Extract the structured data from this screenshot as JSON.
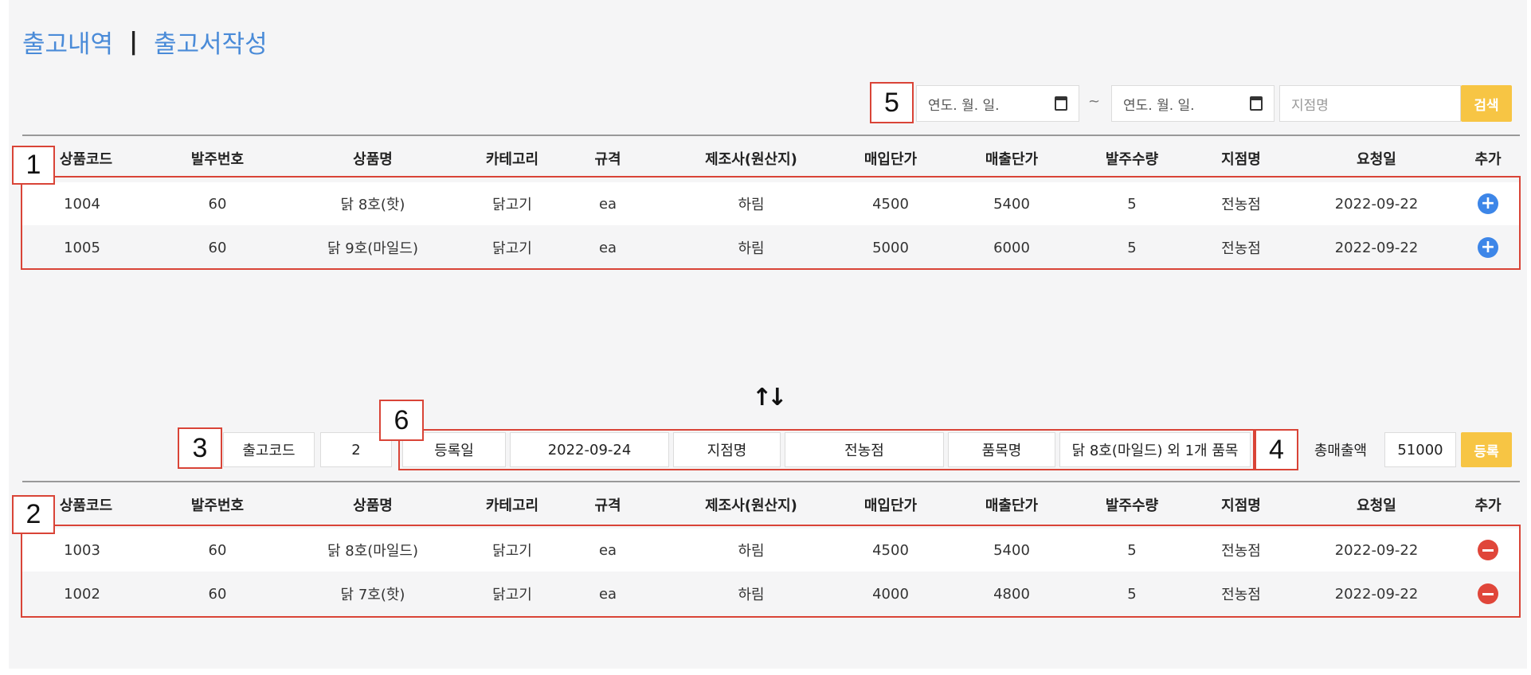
{
  "header": {
    "tab_history": "출고내역",
    "separator": "|",
    "tab_write": "출고서작성"
  },
  "search": {
    "start_date_placeholder": "연도. 월. 일.",
    "tilde": "~",
    "end_date_placeholder": "연도. 월. 일.",
    "branch_placeholder": "지점명",
    "search_label": "검색"
  },
  "columns": [
    "상품코드",
    "발주번호",
    "상품명",
    "카테고리",
    "규격",
    "제조사(원산지)",
    "매입단가",
    "매출단가",
    "발주수량",
    "지점명",
    "요청일",
    "추가"
  ],
  "top_rows": [
    {
      "code": "1004",
      "order": "60",
      "name": "닭 8호(핫)",
      "category": "닭고기",
      "spec": "ea",
      "maker": "하림",
      "buy": "4500",
      "sell": "5400",
      "qty": "5",
      "branch": "전농점",
      "date": "2022-09-22"
    },
    {
      "code": "1005",
      "order": "60",
      "name": "닭 9호(마일드)",
      "category": "닭고기",
      "spec": "ea",
      "maker": "하림",
      "buy": "5000",
      "sell": "6000",
      "qty": "5",
      "branch": "전농점",
      "date": "2022-09-22"
    }
  ],
  "info": {
    "code_label": "출고코드",
    "code_value": "2",
    "reg_label": "등록일",
    "reg_value": "2022-09-24",
    "branch_label": "지점명",
    "branch_value": "전농점",
    "item_label": "품목명",
    "item_value": "닭 8호(마일드) 외 1개 품목",
    "total_label": "총매출액",
    "total_value": "51000",
    "register_label": "등록"
  },
  "bottom_rows": [
    {
      "code": "1003",
      "order": "60",
      "name": "닭 8호(마일드)",
      "category": "닭고기",
      "spec": "ea",
      "maker": "하림",
      "buy": "4500",
      "sell": "5400",
      "qty": "5",
      "branch": "전농점",
      "date": "2022-09-22"
    },
    {
      "code": "1002",
      "order": "60",
      "name": "닭 7호(핫)",
      "category": "닭고기",
      "spec": "ea",
      "maker": "하림",
      "buy": "4000",
      "sell": "4800",
      "qty": "5",
      "branch": "전농점",
      "date": "2022-09-22"
    }
  ],
  "swap_icon": "↑↓",
  "markers": [
    "1",
    "2",
    "3",
    "4",
    "5",
    "6"
  ],
  "colors": {
    "link": "#4a8bd8",
    "button": "#f7c544",
    "add_icon": "#3d86e8",
    "remove_icon": "#e0463a",
    "annotation": "#d94437"
  }
}
